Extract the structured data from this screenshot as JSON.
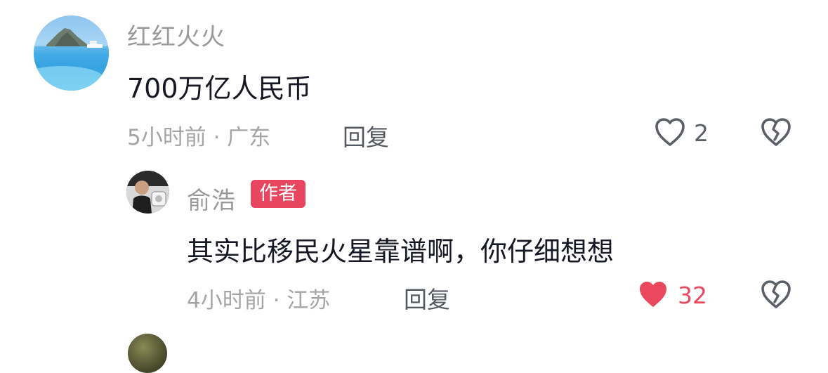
{
  "comments": [
    {
      "username": "红红火火",
      "content": "700万亿人民币",
      "meta": "5小时前 · 广东",
      "reply_label": "回复",
      "like_count": "2",
      "liked": false
    }
  ],
  "reply": {
    "username": "俞浩",
    "badge": "作者",
    "content": "其实比移民火星靠谱啊，你仔细想想",
    "meta": "4小时前 · 江苏",
    "reply_label": "回复",
    "like_count": "32",
    "liked": true
  },
  "colors": {
    "liked": "#e9485e",
    "badge": "#e84560",
    "text_primary": "#161823",
    "text_secondary": "#a5a5a5"
  },
  "icons": {
    "like": "heart-outline-icon",
    "liked": "heart-filled-icon",
    "dislike": "broken-heart-icon"
  }
}
